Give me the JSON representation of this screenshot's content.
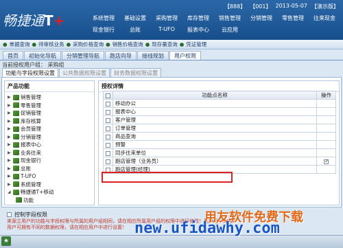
{
  "header": {
    "logo_text": "畅捷通",
    "logo_t": "T",
    "logo_plus": "+",
    "status": [
      "【888】",
      "【001】",
      "2013-05-07",
      "【演示版】"
    ],
    "menu": [
      "系统管理",
      "基础设置",
      "采购管理",
      "库存管理",
      "销售管理",
      "分销管理",
      "零售管理",
      "往来现金",
      "现金银行",
      "总账",
      "T-UFO",
      "报表中心",
      "云应用"
    ]
  },
  "quickbar": [
    "单据查询",
    "待审核业务",
    "采购价格查询",
    "销售价格查询",
    "现存量查询",
    "凭证管理"
  ],
  "tabs": [
    "首页",
    "初始化导航",
    "分销管理导航",
    "跑店向导",
    "接线规划",
    "用户权限"
  ],
  "crumb": "当前授权用户组：   采购组",
  "subtabs": [
    "功能与字段权限设置",
    "公共数据权限设置",
    "财务数据权限设置"
  ],
  "left": {
    "title": "产品功能",
    "tree": [
      {
        "label": "销售管理"
      },
      {
        "label": "零售管理"
      },
      {
        "label": "促销管理"
      },
      {
        "label": "库存核算"
      },
      {
        "label": "会员管理"
      },
      {
        "label": "分销管理"
      },
      {
        "label": "报表中心"
      },
      {
        "label": "业务往来"
      },
      {
        "label": "现金银行"
      },
      {
        "label": "总账"
      },
      {
        "label": "T-UFO"
      },
      {
        "label": "系统管理"
      },
      {
        "label": "畅捷通T+移动"
      }
    ],
    "child": "功能"
  },
  "right": {
    "title": "授权详情",
    "col_name": "功能点名称",
    "col_op": "操作",
    "rows": [
      {
        "name": "移动办公",
        "checked": false
      },
      {
        "name": "报表中心",
        "checked": false
      },
      {
        "name": "客户管理",
        "checked": false
      },
      {
        "name": "订单管理",
        "checked": false
      },
      {
        "name": "商品查询",
        "checked": false
      },
      {
        "name": "预警",
        "checked": false
      },
      {
        "name": "同步往来单位",
        "checked": false
      },
      {
        "name": "跑店管理（业务员）",
        "checked": true
      },
      {
        "name": "跑店管理(经理)",
        "checked": false
      }
    ]
  },
  "bottom": {
    "ctrl_label": "控制字段权限",
    "note": "来源立用户的功能与字段权限与所属的用户组相同，请在相应所属用户组的权限中进行修改！用户组下的各用户可拥有不同的数据权限，请在相应用户中进行设置！"
  },
  "watermark": {
    "line1": "用友软件免费下载",
    "line2": "new.ufidawhy.com"
  }
}
